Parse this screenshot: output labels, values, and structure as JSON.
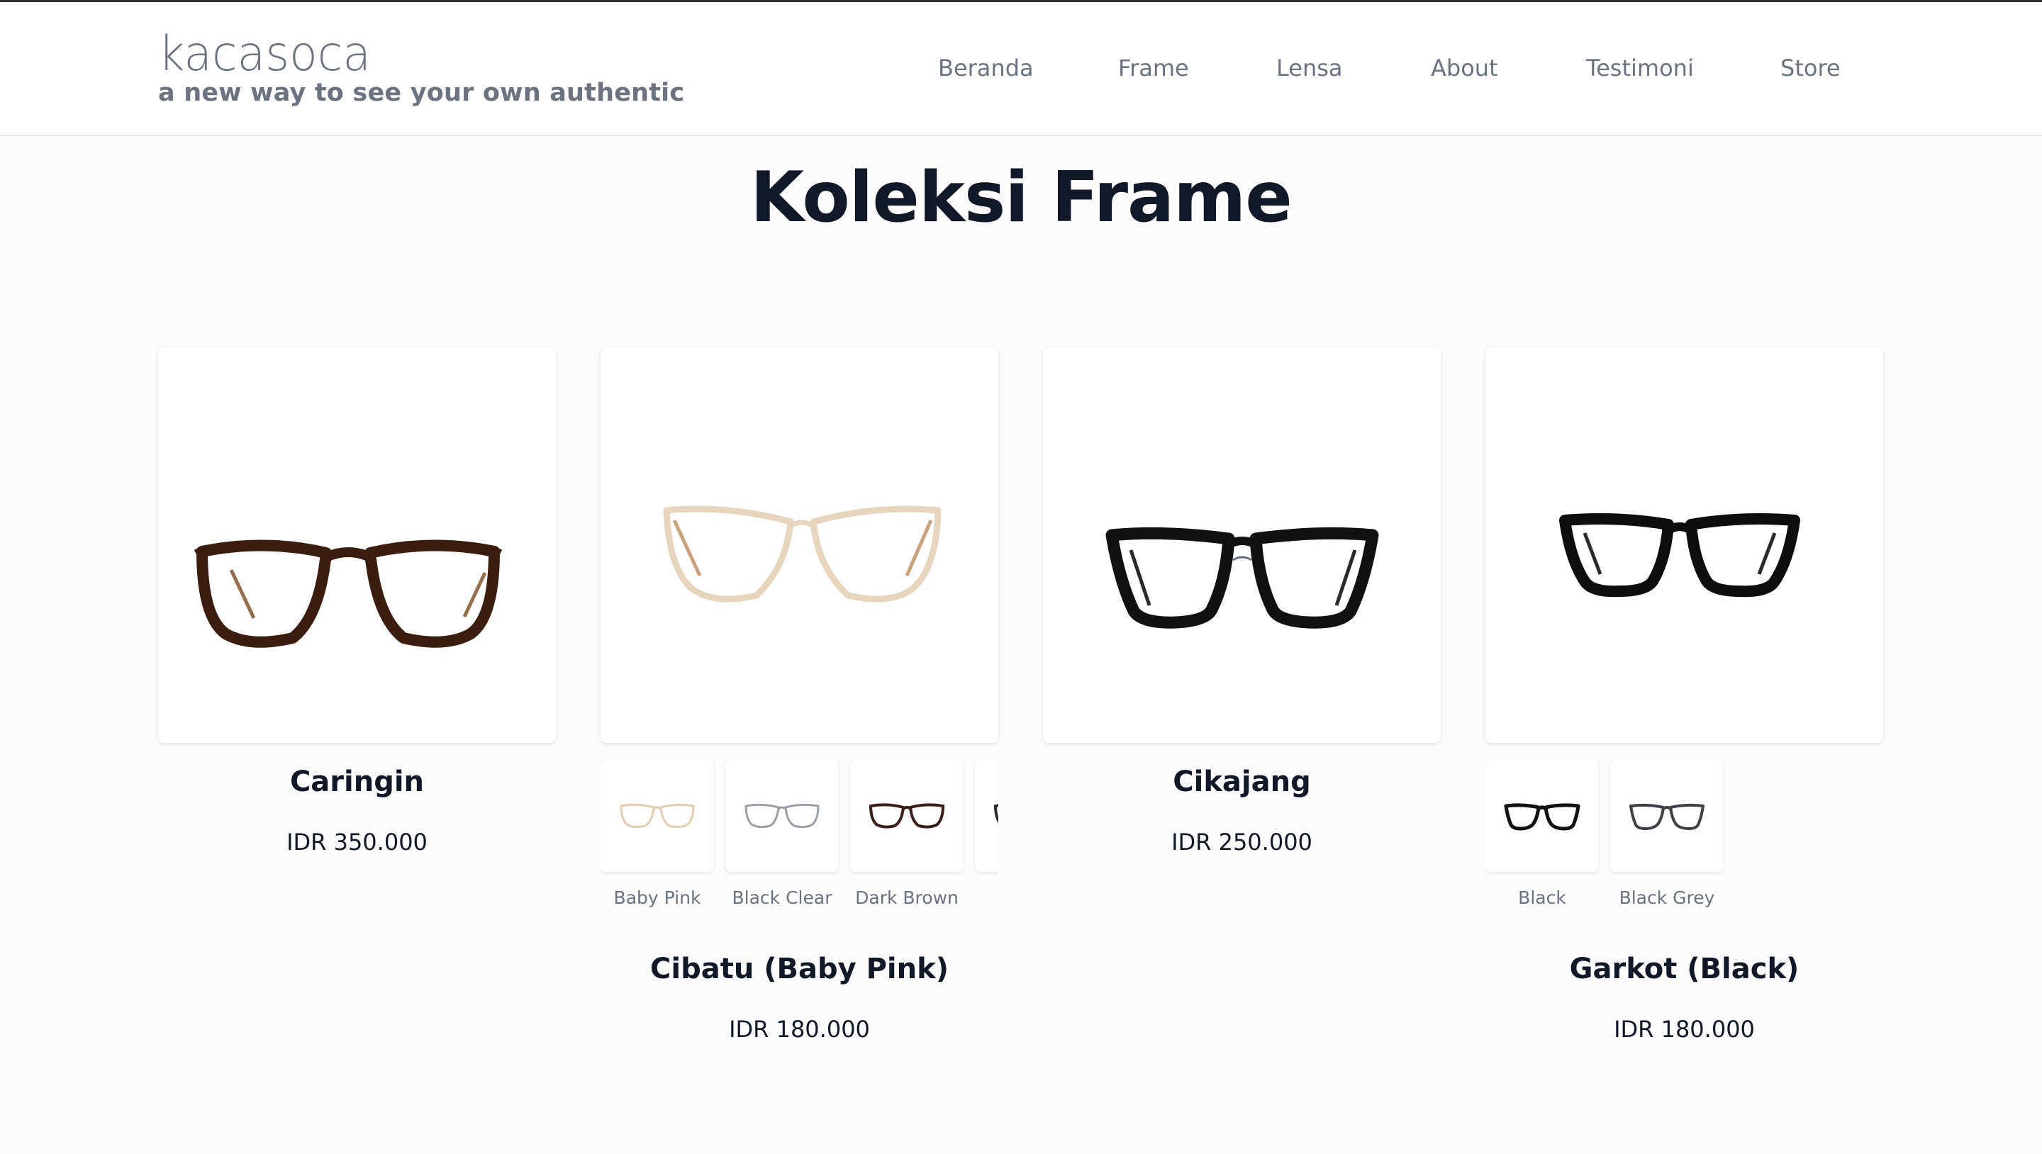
{
  "brand": {
    "logo_text": "kacasoca",
    "tagline": "a new way to see your own authentic"
  },
  "nav": {
    "items": [
      "Beranda",
      "Frame",
      "Lensa",
      "About",
      "Testimoni",
      "Store"
    ]
  },
  "page": {
    "title": "Koleksi Frame"
  },
  "products": [
    {
      "name": "Caringin",
      "price": "IDR 350.000",
      "frame_color": "#3b1d0f",
      "variants": []
    },
    {
      "name": "Cibatu (Baby Pink)",
      "price": "IDR 180.000",
      "frame_color": "#e8d5bd",
      "variants": [
        {
          "label": "Baby Pink",
          "color": "#e3cdb0"
        },
        {
          "label": "Black Clear",
          "color": "#9aa0a6"
        },
        {
          "label": "Dark Brown",
          "color": "#3a1e18"
        }
      ]
    },
    {
      "name": "Cikajang",
      "price": "IDR 250.000",
      "frame_color": "#111111",
      "variants": []
    },
    {
      "name": "Garkot (Black)",
      "price": "IDR 180.000",
      "frame_color": "#0d0d0d",
      "variants": [
        {
          "label": "Black",
          "color": "#111111"
        },
        {
          "label": "Black Grey",
          "color": "#3f3f46"
        }
      ]
    }
  ]
}
